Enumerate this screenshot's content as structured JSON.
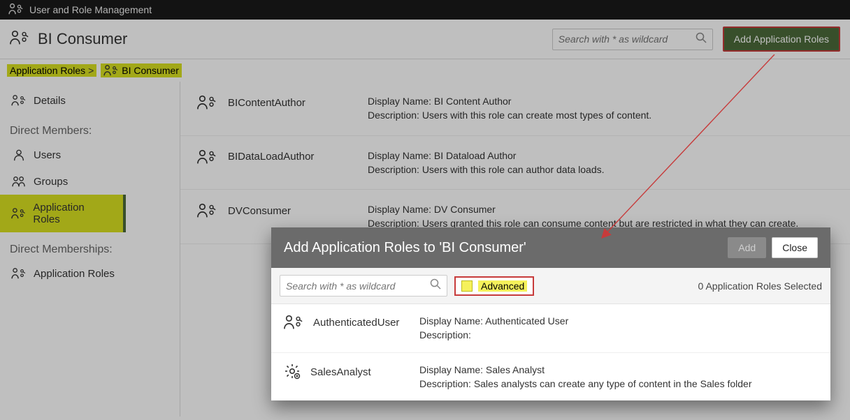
{
  "topbar": {
    "title": "User and Role Management"
  },
  "header": {
    "title": "BI Consumer",
    "search_placeholder": "Search with * as wildcard",
    "add_button": "Add Application Roles"
  },
  "breadcrumb": {
    "root": "Application Roles",
    "sep": ">",
    "current": "BI Consumer"
  },
  "sidebar": {
    "details": "Details",
    "heading_members": "Direct Members:",
    "users": "Users",
    "groups": "Groups",
    "app_roles": "Application Roles",
    "heading_memberships": "Direct Memberships:",
    "memb_app_roles": "Application Roles"
  },
  "labels": {
    "display_name": "Display Name:",
    "description": "Description:"
  },
  "roles": [
    {
      "id": "BIContentAuthor",
      "display": "BI Content Author",
      "desc": "Users with this role can create most types of content."
    },
    {
      "id": "BIDataLoadAuthor",
      "display": "BI Dataload Author",
      "desc": "Users with this role can author data loads."
    },
    {
      "id": "DVConsumer",
      "display": "DV Consumer",
      "desc": "Users granted this role can consume content but are restricted in what they can create."
    }
  ],
  "dialog": {
    "title": "Add Application Roles to 'BI Consumer'",
    "add": "Add",
    "close": "Close",
    "search_placeholder": "Search with * as wildcard",
    "advanced": "Advanced",
    "status": "0 Application Roles Selected",
    "roles": [
      {
        "id": "AuthenticatedUser",
        "display": "Authenticated User",
        "desc": "",
        "icon": "role"
      },
      {
        "id": "SalesAnalyst",
        "display": "Sales Analyst",
        "desc": "Sales analysts can create any type of content in the Sales folder",
        "icon": "gear"
      }
    ]
  }
}
